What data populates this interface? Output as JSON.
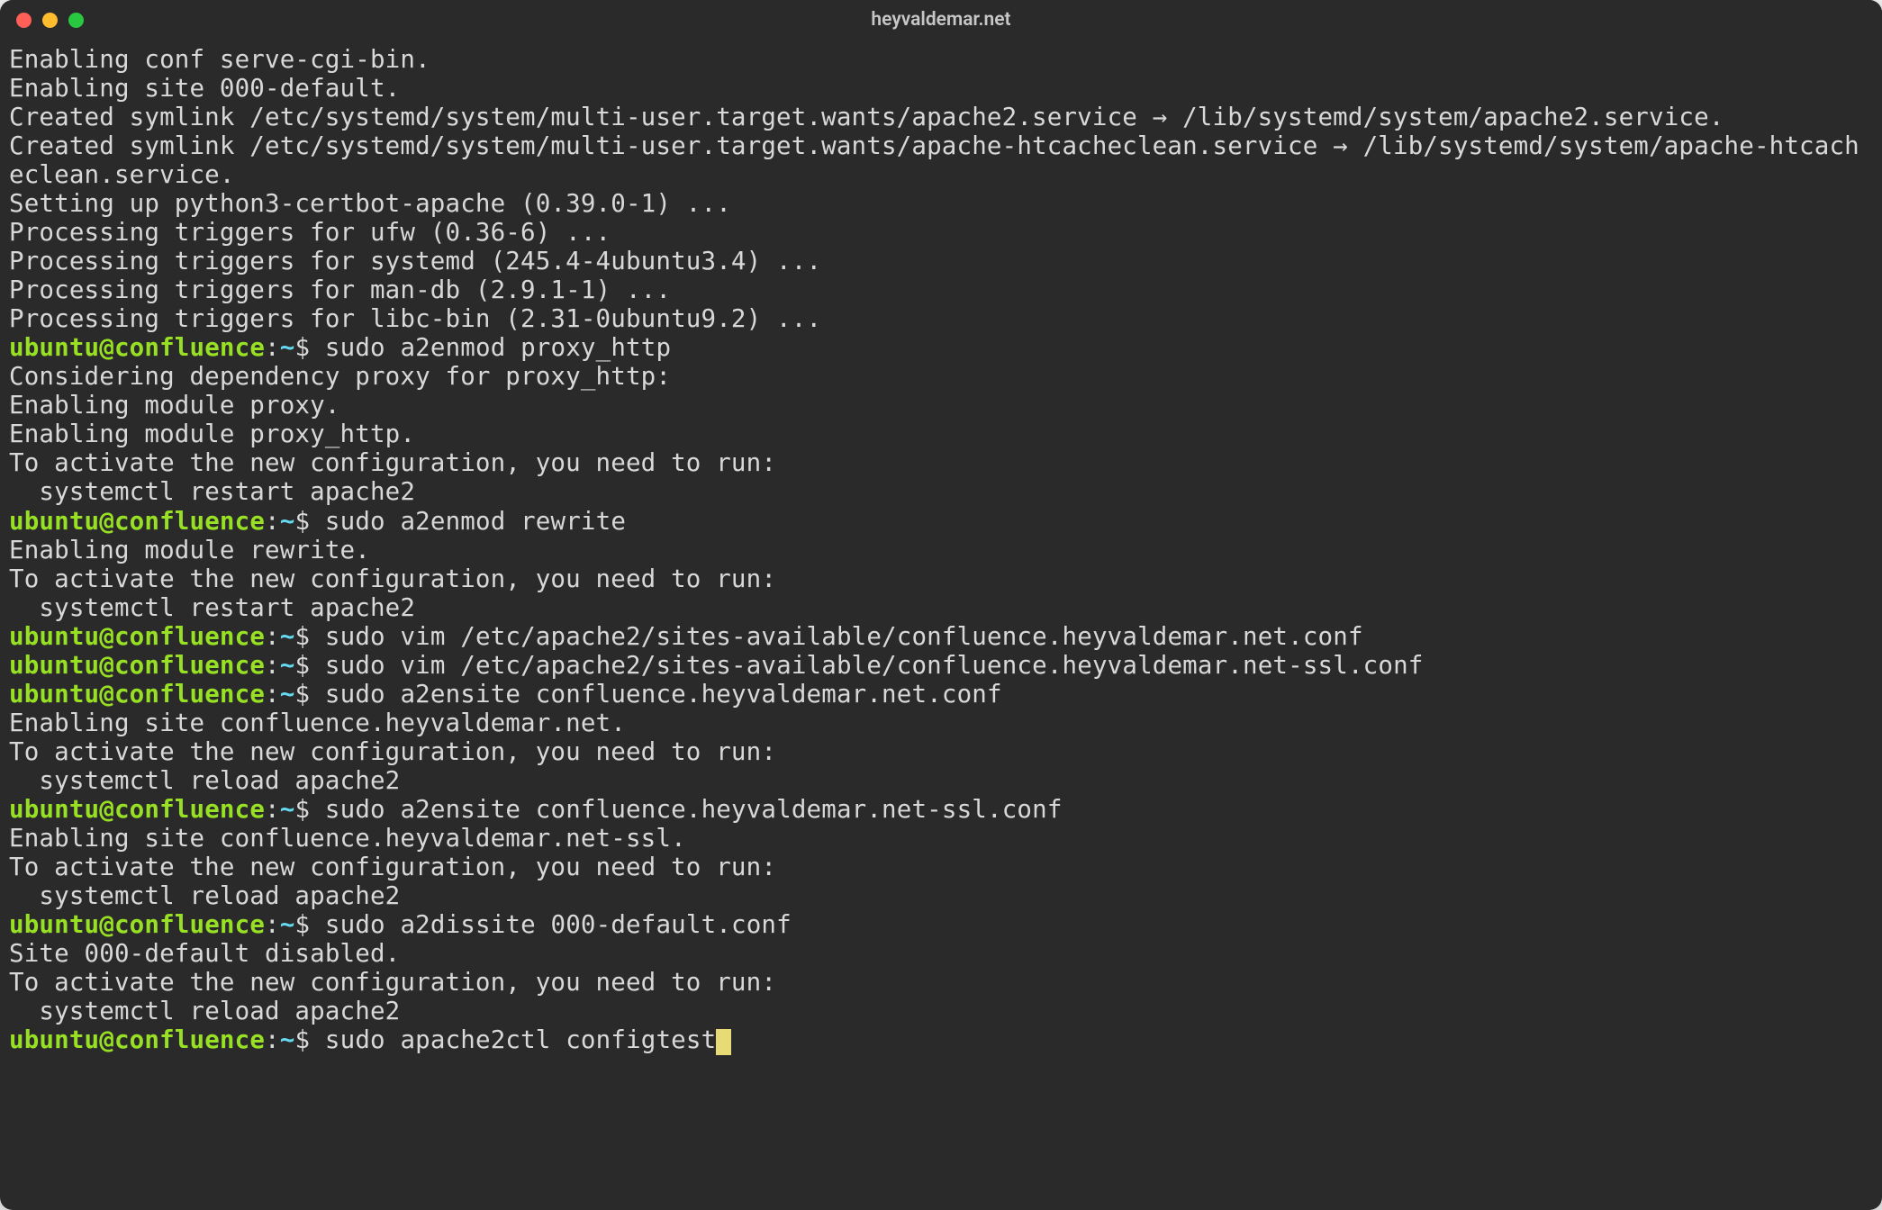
{
  "window": {
    "title": "heyvaldemar.net"
  },
  "prompt": {
    "user": "ubuntu",
    "host": "confluence",
    "path": "~",
    "dollar": "$"
  },
  "lines": {
    "l0": "Enabling conf serve-cgi-bin.",
    "l1": "Enabling site 000-default.",
    "l2": "Created symlink /etc/systemd/system/multi-user.target.wants/apache2.service → /lib/systemd/system/apache2.service.",
    "l3": "Created symlink /etc/systemd/system/multi-user.target.wants/apache-htcacheclean.service → /lib/systemd/system/apache-htcacheclean.service.",
    "l4": "Setting up python3-certbot-apache (0.39.0-1) ...",
    "l5": "Processing triggers for ufw (0.36-6) ...",
    "l6": "Processing triggers for systemd (245.4-4ubuntu3.4) ...",
    "l7": "Processing triggers for man-db (2.9.1-1) ...",
    "l8": "Processing triggers for libc-bin (2.31-0ubuntu9.2) ...",
    "c1": "sudo a2enmod proxy_http",
    "l9": "Considering dependency proxy for proxy_http:",
    "l10": "Enabling module proxy.",
    "l11": "Enabling module proxy_http.",
    "l12": "To activate the new configuration, you need to run:",
    "l13": "  systemctl restart apache2",
    "c2": "sudo a2enmod rewrite",
    "l14": "Enabling module rewrite.",
    "l15": "To activate the new configuration, you need to run:",
    "l16": "  systemctl restart apache2",
    "c3": "sudo vim /etc/apache2/sites-available/confluence.heyvaldemar.net.conf",
    "c4": "sudo vim /etc/apache2/sites-available/confluence.heyvaldemar.net-ssl.conf",
    "c5": "sudo a2ensite confluence.heyvaldemar.net.conf",
    "l17": "Enabling site confluence.heyvaldemar.net.",
    "l18": "To activate the new configuration, you need to run:",
    "l19": "  systemctl reload apache2",
    "c6": "sudo a2ensite confluence.heyvaldemar.net-ssl.conf",
    "l20": "Enabling site confluence.heyvaldemar.net-ssl.",
    "l21": "To activate the new configuration, you need to run:",
    "l22": "  systemctl reload apache2",
    "c7": "sudo a2dissite 000-default.conf",
    "l23": "Site 000-default disabled.",
    "l24": "To activate the new configuration, you need to run:",
    "l25": "  systemctl reload apache2",
    "c8": "sudo apache2ctl configtest"
  }
}
